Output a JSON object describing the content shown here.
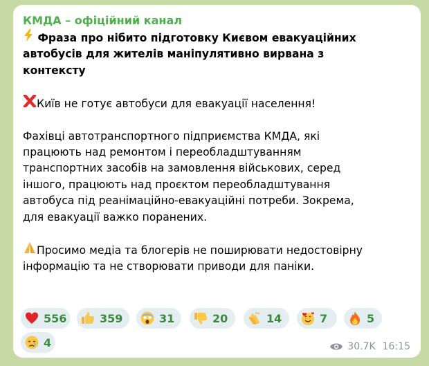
{
  "post": {
    "channel_name": "КМДА – офіційний канал",
    "headline_icon": "lightning-icon",
    "headline_lines": [
      "Фраза про нібито підготовку Києвом евакуаційних",
      "автобусів для жителів маніпулятивно вирвана з",
      "контексту"
    ],
    "denial_icon": "red-cross-icon",
    "denial": "Київ не готує автобуси для евакуації населення!",
    "body_lines": [
      "Фахівці автотранспортного підприємства КМДА, які",
      "працюють над ремонтом і переобладштуванням",
      "транспортних засобів на замовлення військових, серед",
      "іншого, працюють над проєктом переобладштування",
      "автобуса під реанімаційно-евакуаційні потреби. Зокрема,",
      "для евакуації важко поранених."
    ],
    "appeal_icon": "praying-hands-icon",
    "appeal_lines": [
      "Просимо медіа та блогерів не поширювати недостовірну",
      "інформацію та не створювати приводи для паніки."
    ]
  },
  "reactions": [
    {
      "icon": "red-heart-icon",
      "count": "556"
    },
    {
      "icon": "thumbs-up-icon",
      "count": "359"
    },
    {
      "icon": "screaming-face-icon",
      "count": "31"
    },
    {
      "icon": "thumbs-down-icon",
      "count": "20"
    },
    {
      "icon": "clapping-hands-icon",
      "count": "14"
    },
    {
      "icon": "smiling-face-with-hearts-icon",
      "count": "7"
    },
    {
      "icon": "fire-icon",
      "count": "5"
    },
    {
      "icon": "crying-face-icon",
      "count": "4"
    }
  ],
  "meta": {
    "views_icon": "eye-icon",
    "views": "30.7K",
    "time": "16:15"
  },
  "colors": {
    "background": "#c7d9a4",
    "bubble": "#ffffff",
    "channel_name": "#4fae4e",
    "reaction_pill": "#e4eef0",
    "reaction_count": "#3b8a40",
    "meta_text": "#8b9298"
  }
}
